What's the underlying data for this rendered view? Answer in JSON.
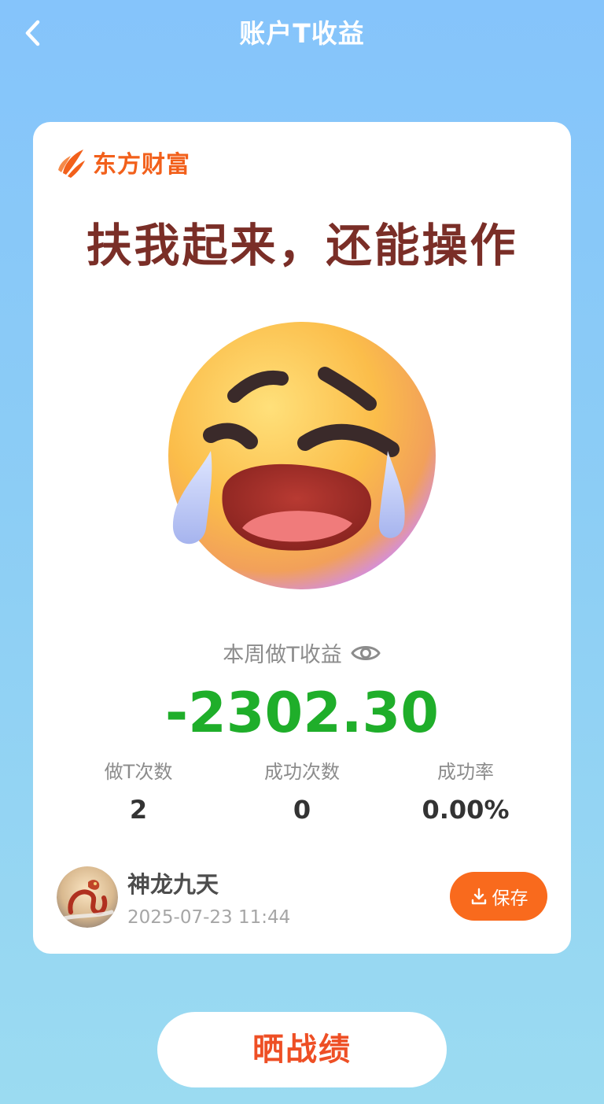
{
  "nav": {
    "title": "账户T收益"
  },
  "brand": {
    "name": "东方财富"
  },
  "card": {
    "headline": "扶我起来，还能操作",
    "metric_label": "本周做T收益",
    "profit": "-2302.30",
    "stats": [
      {
        "label": "做T次数",
        "value": "2"
      },
      {
        "label": "成功次数",
        "value": "0"
      },
      {
        "label": "成功率",
        "value": "0.00%"
      }
    ],
    "user": {
      "name": "神龙九天",
      "time": "2025-07-23 11:44"
    },
    "save_label": "保存"
  },
  "share_label": "晒战绩",
  "icons": {
    "back": "chevron-left-icon",
    "eye": "eye-icon",
    "download": "download-icon",
    "emoji": "crying-face-emoji"
  },
  "colors": {
    "brand": "#f2601b",
    "headline": "#7a2e27",
    "loss_green": "#1fae2a",
    "save_button": "#f96a1d",
    "share_text": "#ee4f25"
  }
}
